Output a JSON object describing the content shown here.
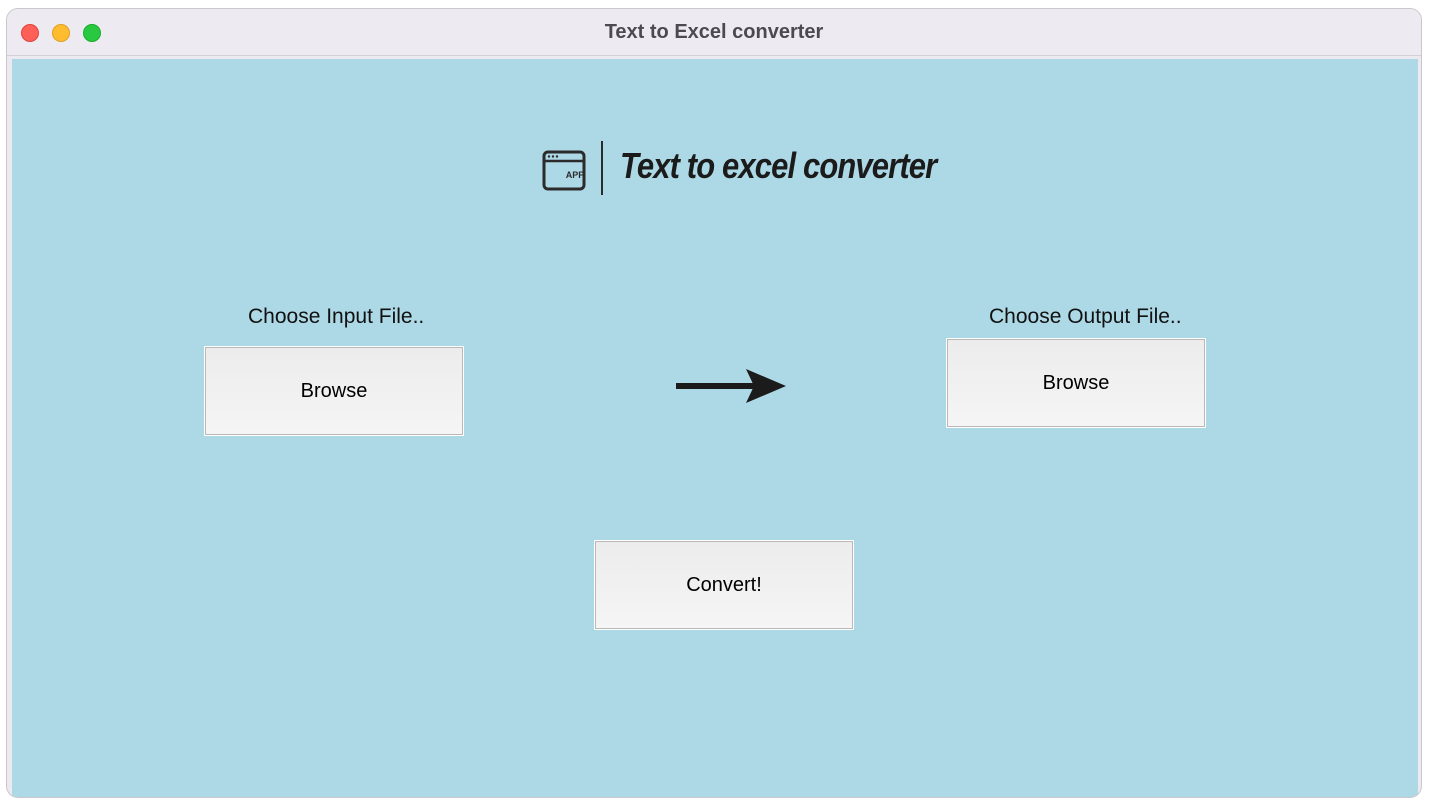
{
  "window": {
    "title": "Text to Excel converter"
  },
  "header": {
    "logo_icon": "app-window-icon",
    "logo_icon_text": "APP",
    "logo_text": "Text to excel converter"
  },
  "input": {
    "label": "Choose Input File..",
    "button_label": "Browse"
  },
  "output": {
    "label": "Choose Output File..",
    "button_label": "Browse"
  },
  "arrow_icon": "right-arrow-icon",
  "convert": {
    "button_label": "Convert!"
  },
  "colors": {
    "background": "#add8e6",
    "button_face": "#f0f0f0",
    "close": "#fe5f57",
    "minimize": "#febc2e",
    "maximize": "#28c840"
  }
}
